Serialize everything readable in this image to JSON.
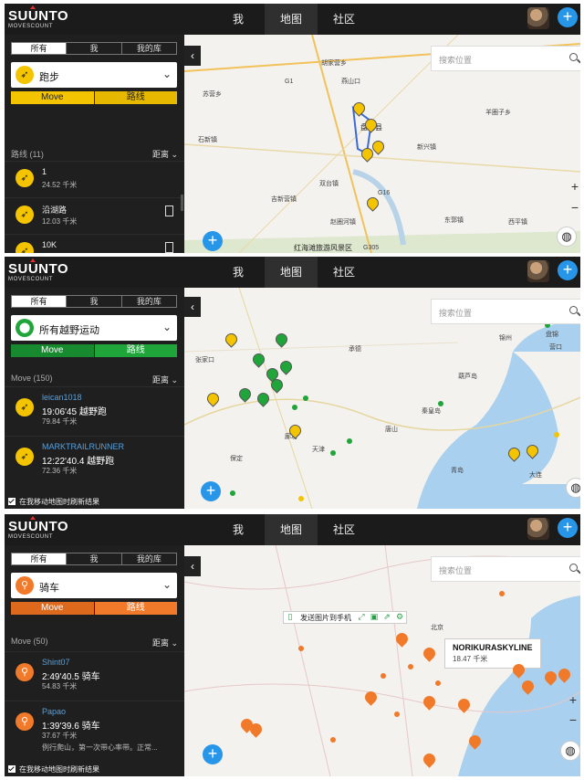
{
  "colors": {
    "yellow": "#f5c400",
    "green": "#1fa53a",
    "orange": "#f07a2a",
    "blue": "#2896e8",
    "dark": "#1b1b1b"
  },
  "header": {
    "brand": "SUUNTO",
    "brand_sub": "MOVESCOUNT",
    "nav": [
      "我",
      "地图",
      "社区"
    ],
    "plus": "+"
  },
  "panels": [
    {
      "tabs": [
        "所有",
        "我",
        "我的库"
      ],
      "activity": "跑步",
      "activity_icon": "running-icon",
      "toggle": [
        "Move",
        "路线"
      ],
      "list_title": "路线 (11)",
      "sort": "距离",
      "items": [
        {
          "t1": "1",
          "t3": "24.52 千米"
        },
        {
          "t1": "沿湖路",
          "t3": "12.03 千米"
        },
        {
          "t1": "10K",
          "t3": ""
        }
      ],
      "search_placeholder": "搜索位置",
      "map_labels": [
        "胡家营乡",
        "苏营乡",
        "G1",
        "燕山口",
        "吉新营镇",
        "红海滩旅游风景区",
        "G305",
        "G16",
        "双台镇",
        "赵圈河镇",
        "新兴镇",
        "西平镇",
        "东郭镇",
        "羊圈子乡",
        "盘山县",
        "石新镇"
      ]
    },
    {
      "tabs": [
        "所有",
        "我",
        "我的库"
      ],
      "activity": "所有越野运动",
      "activity_icon": "location-pin-icon",
      "toggle": [
        "Move",
        "路线"
      ],
      "list_title": "Move (150)",
      "sort": "距离",
      "items": [
        {
          "t1": "leican1018",
          "t2": "19:06'45 越野跑",
          "t3": "79.84 千米"
        },
        {
          "t1": "MARKTRAILRUNNER",
          "t2": "12:22'40.4 越野跑",
          "t3": "72.36 千米"
        }
      ],
      "refresh": "在我移动地图时刷新结果",
      "search_placeholder": "搜索位置",
      "map_labels": [
        "张家口",
        "承德",
        "秦皇岛",
        "唐山",
        "天津",
        "保定",
        "廊坊",
        "锦州",
        "葫芦岛",
        "营口",
        "盘锦",
        "大连",
        "青岛"
      ]
    },
    {
      "tabs": [
        "所有",
        "我",
        "我的库"
      ],
      "activity": "骑车",
      "activity_icon": "bicycle-icon",
      "toggle": [
        "Move",
        "路线"
      ],
      "list_title": "Move (50)",
      "sort": "距离",
      "items": [
        {
          "t1": "Shint07",
          "t2": "2:49'40.5 骑车",
          "t3": "54.83 千米"
        },
        {
          "t1": "Papao",
          "t2": "1:39'39.6 骑车",
          "t3": "37.67 千米",
          "t4": "例行爬山，第一次带心率带。正常..."
        }
      ],
      "refresh": "在我移动地图时刷新结果",
      "search_placeholder": "搜索位置",
      "toolbar_label": "发送图片到手机",
      "popup_title": "NORIKURASKYLINE",
      "popup_sub": "18.47 千米",
      "map_labels": [
        "北京"
      ]
    }
  ]
}
